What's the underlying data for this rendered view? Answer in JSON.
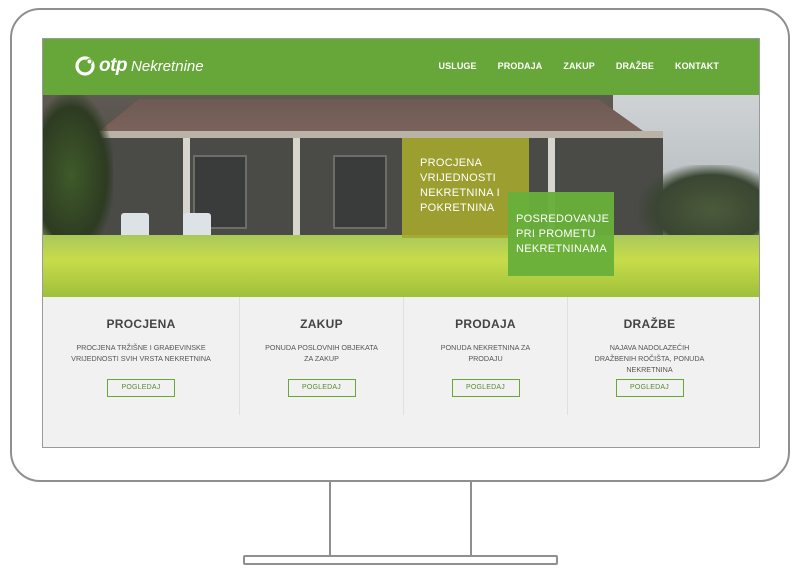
{
  "brand": {
    "logo_text": "otp",
    "name": "Nekretnine",
    "color": "#67a73a"
  },
  "nav": {
    "items": [
      "USLUGE",
      "PRODAJA",
      "ZAKUP",
      "DRAŽBE",
      "KONTAKT"
    ]
  },
  "hero": {
    "box1": "PROCJENA VRIJEDNOSTI NEKRETNINA I POKRETNINA",
    "box2": "POSREDOVANJE PRI PROMETU NEKRETNINAMA"
  },
  "cards": [
    {
      "title": "PROCJENA",
      "text": "PROCJENA TRŽIŠNE I GRAĐEVINSKE VRIJEDNOSTI SVIH VRSTA NEKRETNINA",
      "button": "POGLEDAJ"
    },
    {
      "title": "ZAKUP",
      "text": "PONUDA POSLOVNIH OBJEKATA ZA ZAKUP",
      "button": "POGLEDAJ"
    },
    {
      "title": "PRODAJA",
      "text": "PONUDA NEKRETNINA ZA PRODAJU",
      "button": "POGLEDAJ"
    },
    {
      "title": "DRAŽBE",
      "text": "NAJAVA NADOLAZEĆIH DRAŽBENIH ROČIŠTA, PONUDA NEKRETNINA",
      "button": "POGLEDAJ"
    }
  ]
}
